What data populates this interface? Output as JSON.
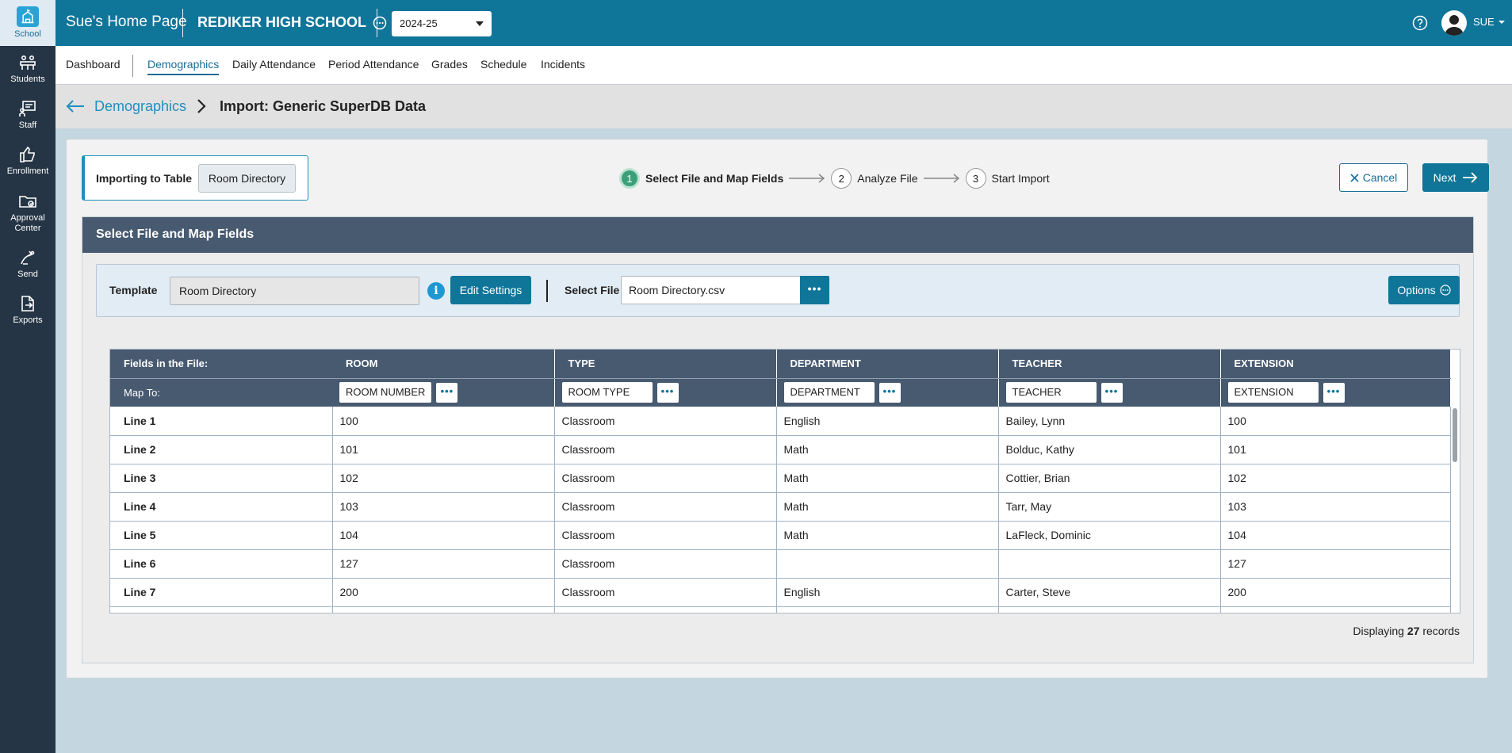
{
  "rail": [
    {
      "label": "School",
      "icon": "school-icon",
      "active": true
    },
    {
      "label": "Students",
      "icon": "students-icon"
    },
    {
      "label": "Staff",
      "icon": "staff-icon"
    },
    {
      "label": "Enrollment",
      "icon": "thumbs-up-icon"
    },
    {
      "label": "Approval Center",
      "icon": "folder-approval-icon"
    },
    {
      "label": "Send",
      "icon": "send-icon"
    },
    {
      "label": "Exports",
      "icon": "export-icon"
    }
  ],
  "header": {
    "home_title": "Sue's Home Page",
    "school_name": "REDIKER HIGH SCHOOL",
    "year": "2024-25",
    "user": "SUE"
  },
  "nav": {
    "items": [
      "Dashboard",
      "Demographics",
      "Daily Attendance",
      "Period Attendance",
      "Grades",
      "Schedule",
      "Incidents"
    ],
    "active": "Demographics"
  },
  "breadcrumb": {
    "parent": "Demographics",
    "current": "Import: Generic SuperDB Data"
  },
  "import_to": {
    "label": "Importing to Table",
    "value": "Room Directory"
  },
  "steps": [
    {
      "num": "1",
      "label": "Select File and Map Fields",
      "current": true
    },
    {
      "num": "2",
      "label": "Analyze File"
    },
    {
      "num": "3",
      "label": "Start Import"
    }
  ],
  "buttons": {
    "cancel": "Cancel",
    "next": "Next",
    "edit_settings": "Edit Settings",
    "options": "Options",
    "dots": "•••"
  },
  "section": {
    "title": "Select File and Map Fields",
    "template_label": "Template",
    "template_value": "Room Directory",
    "file_label": "Select File",
    "file_value": "Room Directory.csv"
  },
  "grid": {
    "fields_label": "Fields in the File:",
    "map_label": "Map To:",
    "columns": [
      "ROOM",
      "TYPE",
      "DEPARTMENT",
      "TEACHER",
      "EXTENSION"
    ],
    "mappings": [
      "ROOM NUMBER",
      "ROOM TYPE",
      "DEPARTMENT",
      "TEACHER",
      "EXTENSION"
    ],
    "rows": [
      {
        "line": "Line 1",
        "cells": [
          "100",
          "Classroom",
          "English",
          "Bailey, Lynn",
          "100"
        ]
      },
      {
        "line": "Line 2",
        "cells": [
          "101",
          "Classroom",
          "Math",
          "Bolduc, Kathy",
          "101"
        ]
      },
      {
        "line": "Line 3",
        "cells": [
          "102",
          "Classroom",
          "Math",
          "Cottier, Brian",
          "102"
        ]
      },
      {
        "line": "Line 4",
        "cells": [
          "103",
          "Classroom",
          "Math",
          "Tarr, May",
          "103"
        ]
      },
      {
        "line": "Line 5",
        "cells": [
          "104",
          "Classroom",
          "Math",
          "LaFleck, Dominic",
          "104"
        ]
      },
      {
        "line": "Line 6",
        "cells": [
          "127",
          "Classroom",
          "",
          "",
          "127"
        ]
      },
      {
        "line": "Line 7",
        "cells": [
          "200",
          "Classroom",
          "English",
          "Carter, Steve",
          "200"
        ]
      },
      {
        "line": "",
        "cells": [
          "",
          "",
          "",
          "",
          ""
        ]
      }
    ],
    "display_prefix": "Displaying",
    "record_count": "27",
    "display_suffix": "records"
  },
  "colors": {
    "topbar": "#0f7599",
    "rail": "#253545",
    "section_head": "#475a70",
    "accent": "#1f8fc0",
    "step_done": "#3aa07a"
  }
}
